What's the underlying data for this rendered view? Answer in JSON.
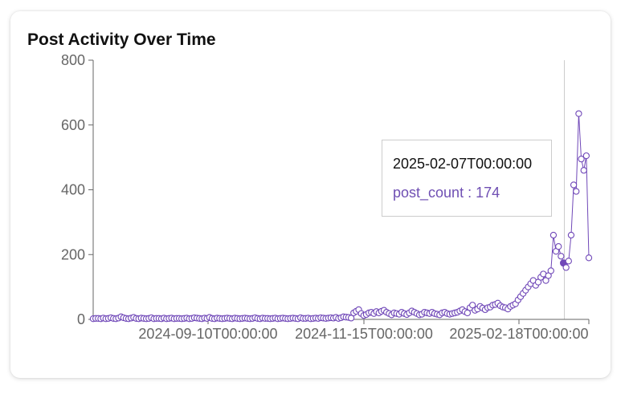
{
  "card": {
    "title": "Post Activity Over Time"
  },
  "tooltip": {
    "label": "2025-02-07T00:00:00",
    "key": "post_count",
    "separator": " : ",
    "value": "174"
  },
  "colors": {
    "series": "#7048b8",
    "axis": "#666666",
    "cursor": "#cccccc"
  },
  "chart_data": {
    "type": "line",
    "title": "Post Activity Over Time",
    "xlabel": "",
    "ylabel": "",
    "ylim": [
      0,
      800
    ],
    "yticks": [
      0,
      200,
      400,
      600,
      800
    ],
    "xticks": [
      "2024-09-10T00:00:00",
      "2024-11-15T00:00:00",
      "2025-02-18T00:00:00"
    ],
    "grid": false,
    "active_point": {
      "x": "2025-02-07T00:00:00",
      "y": 174
    },
    "series": [
      {
        "name": "post_count",
        "values": [
          2,
          3,
          3,
          2,
          4,
          2,
          3,
          5,
          3,
          2,
          4,
          8,
          5,
          3,
          2,
          4,
          6,
          3,
          2,
          4,
          3,
          2,
          3,
          5,
          2,
          3,
          3,
          2,
          4,
          2,
          3,
          4,
          2,
          3,
          3,
          2,
          3,
          4,
          2,
          3,
          5,
          4,
          3,
          2,
          4,
          3,
          6,
          3,
          2,
          4,
          3,
          2,
          3,
          4,
          3,
          2,
          4,
          3,
          2,
          3,
          4,
          3,
          2,
          3,
          5,
          3,
          2,
          4,
          3,
          3,
          2,
          3,
          4,
          2,
          3,
          4,
          3,
          2,
          3,
          4,
          3,
          2,
          5,
          3,
          3,
          4,
          2,
          3,
          4,
          3,
          5,
          4,
          3,
          4,
          5,
          4,
          6,
          3,
          5,
          8,
          7,
          6,
          4,
          20,
          25,
          30,
          18,
          12,
          15,
          20,
          22,
          18,
          24,
          20,
          25,
          28,
          22,
          18,
          14,
          20,
          18,
          16,
          22,
          18,
          15,
          20,
          26,
          22,
          18,
          14,
          16,
          22,
          20,
          18,
          22,
          18,
          16,
          14,
          20,
          22,
          18,
          16,
          18,
          20,
          22,
          26,
          30,
          24,
          20,
          36,
          44,
          28,
          32,
          40,
          35,
          30,
          36,
          38,
          44,
          46,
          50,
          42,
          38,
          36,
          32,
          40,
          44,
          48,
          60,
          70,
          80,
          90,
          100,
          110,
          120,
          105,
          115,
          130,
          140,
          120,
          135,
          150,
          260,
          210,
          225,
          195,
          174,
          160,
          180,
          260,
          415,
          395,
          635,
          495,
          460,
          505,
          190
        ]
      }
    ]
  }
}
